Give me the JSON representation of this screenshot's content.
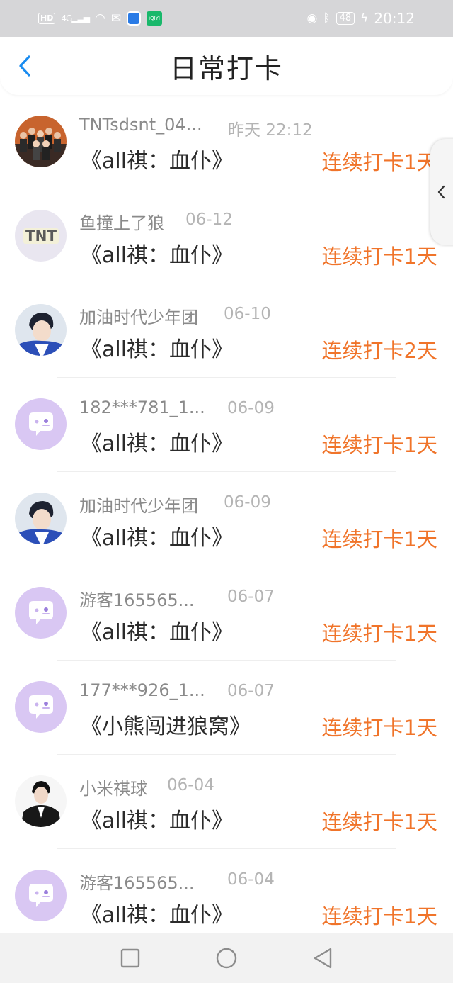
{
  "status_bar": {
    "network_badge": "HD",
    "signal": "4G",
    "battery": "48",
    "time": "20:12",
    "app_badge": "iQIYI"
  },
  "header": {
    "title": "日常打卡"
  },
  "entries": [
    {
      "name": "TNTsdsnt_04...",
      "date": "昨天 22:12",
      "book": "《all祺：血仆》",
      "streak": "连续打卡1天",
      "avatar": "group-photo"
    },
    {
      "name": "鱼撞上了狼",
      "date": "06-12",
      "book": "《all祺：血仆》",
      "streak": "连续打卡1天",
      "avatar": "tnt-logo"
    },
    {
      "name": "加油时代少年团",
      "date": "06-10",
      "book": "《all祺：血仆》",
      "streak": "连续打卡2天",
      "avatar": "person-photo"
    },
    {
      "name": "182***781_1...",
      "date": "06-09",
      "book": "《all祺：血仆》",
      "streak": "连续打卡1天",
      "avatar": "default-chat"
    },
    {
      "name": "加油时代少年团",
      "date": "06-09",
      "book": "《all祺：血仆》",
      "streak": "连续打卡1天",
      "avatar": "person-photo"
    },
    {
      "name": "游客165565...",
      "date": "06-07",
      "book": "《all祺：血仆》",
      "streak": "连续打卡1天",
      "avatar": "default-chat"
    },
    {
      "name": "177***926_1...",
      "date": "06-07",
      "book": "《小熊闯进狼窝》",
      "streak": "连续打卡1天",
      "avatar": "default-chat"
    },
    {
      "name": "小米祺球",
      "date": "06-04",
      "book": "《all祺：血仆》",
      "streak": "连续打卡1天",
      "avatar": "dark-suit-photo"
    },
    {
      "name": "游客165565...",
      "date": "06-04",
      "book": "《all祺：血仆》",
      "streak": "连续打卡1天",
      "avatar": "default-chat"
    }
  ],
  "colors": {
    "accent": "#f0742a",
    "back_arrow": "#1a8cf0",
    "default_avatar": "#d9c7f3"
  }
}
